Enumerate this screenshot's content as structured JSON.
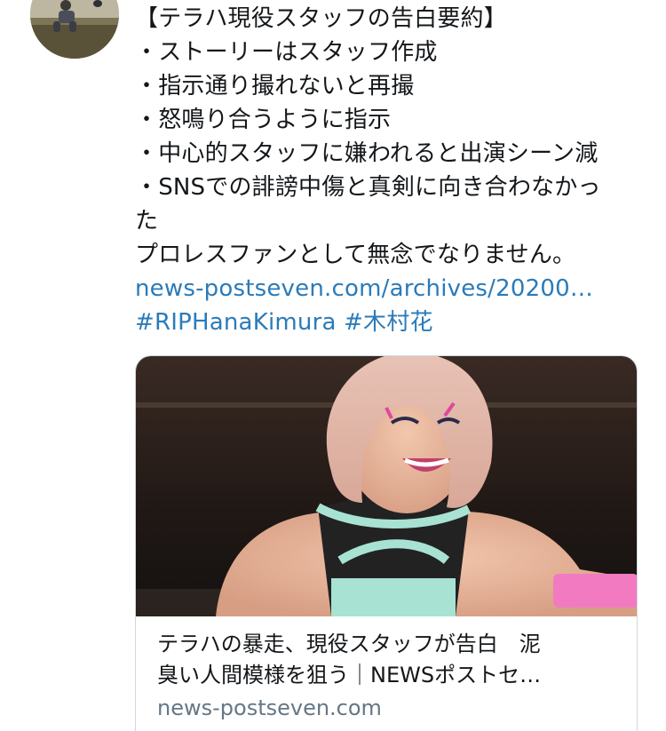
{
  "tweet": {
    "lines": [
      "【テラハ現役スタッフの告白要約】",
      "・ストーリーはスタッフ作成",
      "・指示通り撮れないと再撮",
      "・怒鳴り合うように指示",
      "・中心的スタッフに嫌われると出演シーン減",
      "・SNSでの誹謗中傷と真剣に向き合わなかっ",
      "た",
      "プロレスファンとして無念でなりません。"
    ],
    "link": "news-postseven.com/archives/20200…",
    "hashtags": [
      "#RIPHanaKimura",
      "#木村花"
    ]
  },
  "card": {
    "title_line1": "テラハの暴走、現役スタッフが告白　泥",
    "title_line2": "臭い人間模様を狙う｜NEWSポストセ…",
    "domain": "news-postseven.com"
  },
  "colors": {
    "link": "#2b7bb9",
    "text": "#14171a",
    "muted": "#657786",
    "border": "#cfd9de"
  }
}
